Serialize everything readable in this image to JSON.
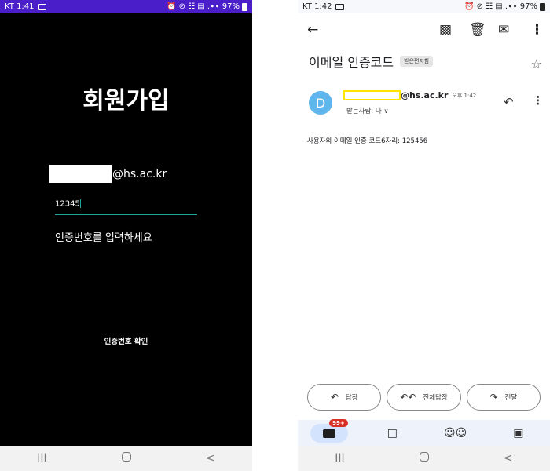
{
  "left": {
    "status": {
      "carrier_time": "KT 1:41",
      "indicators": "⏰ ⊘ ☷ ▤ .∙∙ 97%"
    },
    "title": "회원가입",
    "email_domain": "@hs.ac.kr",
    "code_value": "12345",
    "prompt": "인증번호를 입력하세요",
    "confirm_button": "인증번호 확인",
    "nav": {
      "recent": "III",
      "back": "<"
    }
  },
  "right": {
    "status": {
      "carrier_time": "KT 1:42",
      "indicators": "⏰ ⊘ ☷ ▤ .∙∙ 97%"
    },
    "subject": "이메일 인증코드",
    "label": "받은편지함",
    "avatar_letter": "D",
    "sender_domain": "@hs.ac.kr",
    "sent_time": "오후 1:42",
    "recipient": "받는사람: 나 ∨",
    "body": "사용자의 이메일 인증 코드6자리: 125456",
    "actions": {
      "reply": "답장",
      "reply_all": "전체답장",
      "forward": "전달"
    },
    "mail_badge": "99+",
    "nav": {
      "recent": "III",
      "back": "<"
    }
  },
  "icons": {
    "back": "back-arrow-icon",
    "archive": "archive-icon",
    "delete": "trash-icon",
    "unread": "mail-icon",
    "more": "more-vert-icon",
    "star": "star-icon",
    "reply": "reply-icon",
    "reply_all": "reply-all-icon",
    "forward": "forward-icon",
    "mail_tab": "mail-icon",
    "chat_tab": "chat-icon",
    "spaces_tab": "people-icon",
    "meet_tab": "video-icon"
  },
  "colors": {
    "left_status": "#4a1fc9",
    "input_underline": "#1aa89a",
    "avatar": "#5fb6ec",
    "sender_highlight": "#ffe500",
    "badge": "#d93025"
  }
}
